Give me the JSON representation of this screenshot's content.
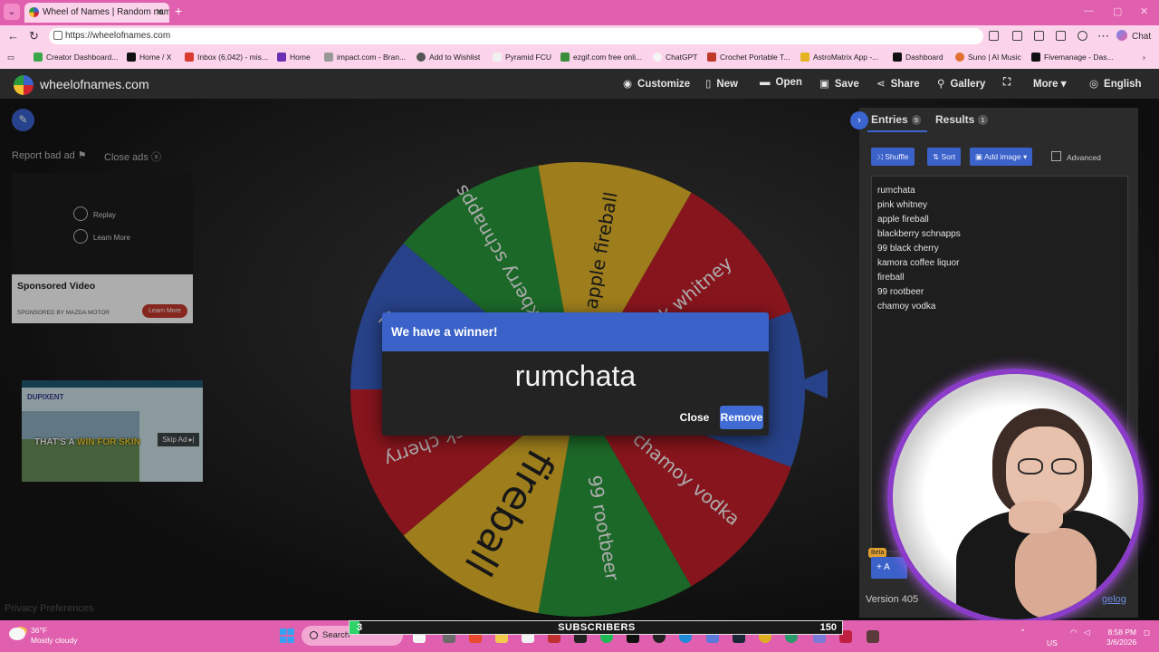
{
  "browser": {
    "tab_title": "Wheel of Names | Random name",
    "url": "https://wheelofnames.com",
    "chat_label": "Chat",
    "bookmarks": [
      "Creator Dashboard...",
      "Home / X",
      "Inbox (6,042) - mis...",
      "Home",
      "impact.com - Bran...",
      "Add to Wishlist",
      "Pyramid FCU",
      "ezgif.com free onli...",
      "ChatGPT",
      "Crochet Portable T...",
      "AstroMatrix App -...",
      "Dashboard",
      "Suno | AI Music",
      "Fivemanage - Das..."
    ]
  },
  "header": {
    "brand": "wheelofnames.com",
    "buttons": {
      "customize": "Customize",
      "new": "New",
      "open": "Open",
      "save": "Save",
      "share": "Share",
      "gallery": "Gallery",
      "more": "More",
      "language": "English"
    }
  },
  "ads": {
    "report": "Report bad ad",
    "close": "Close ads",
    "replay": "Replay",
    "learn_more": "Learn More",
    "sponsored_title": "Sponsored Video",
    "sponsored_by": "SPONSORED BY MAZDA MOTOR",
    "learn_button": "Learn More",
    "banner_text_1": "THAT'S A ",
    "banner_text_2": "WIN FOR SKIN",
    "skip": "Skip Ad ▸|",
    "brand2": "DUPIXENT"
  },
  "privacy": "Privacy Preferences",
  "wheel": {
    "segments": [
      {
        "label": "rumchata",
        "color": "#3a62c9"
      },
      {
        "label": "chamoy vodka",
        "color": "#c8202b"
      },
      {
        "label": "99 rootbeer",
        "color": "#2a9a3b"
      },
      {
        "label": "fireball",
        "color": "#e8b82a"
      },
      {
        "label": "...black cherry",
        "color": "#c8202b"
      },
      {
        "label": "99 black cherry",
        "color": "#3a62c9"
      },
      {
        "label": "blackberry schnapps",
        "color": "#2a9a3b"
      },
      {
        "label": "apple fireball",
        "color": "#e8b82a"
      },
      {
        "label": "pink whitney",
        "color": "#c8202b"
      }
    ],
    "visible_labels": [
      "rumchata",
      "chamoy vodka",
      "99 rootbeer",
      "fireball",
      "...b",
      "cherry",
      "...kberry schnap...",
      "apple fireball",
      "...k whitney"
    ]
  },
  "dialog": {
    "title": "We have a winner!",
    "winner": "rumchata",
    "close": "Close",
    "remove": "Remove"
  },
  "panel": {
    "entries_tab": "Entries",
    "entries_count": "9",
    "results_tab": "Results",
    "results_count": "1",
    "shuffle": "Shuffle",
    "sort": "Sort",
    "add_image": "Add image",
    "advanced": "Advanced",
    "entries": [
      "rumchata",
      "pink whitney",
      "apple fireball",
      "blackberry schnapps",
      "99 black cherry",
      "kamora coffee liquor",
      "fireball",
      "99 rootbeer",
      "chamoy vodka"
    ],
    "beta": "Beta",
    "add_button": "A",
    "version": "Version 405",
    "changelog": "gelog"
  },
  "taskbar": {
    "temp": "36°F",
    "weather": "Mostly cloudy",
    "search": "Search",
    "subs_current": "3",
    "subs_label": "SUBSCRIBERS",
    "subs_goal": "150",
    "subs_progress": 0.02,
    "region": "US",
    "time": "8:58 PM",
    "date": "3/6/2026"
  }
}
